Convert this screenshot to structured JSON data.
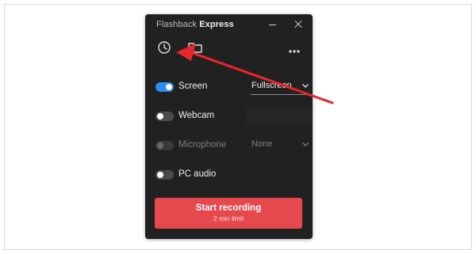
{
  "app": {
    "title_light": "Flashback",
    "title_bold": "Express"
  },
  "window_controls": {
    "minimize_icon": "minimize-icon",
    "close_icon": "close-icon"
  },
  "toolbar": {
    "history_icon": "clock-icon",
    "folder_icon": "folder-icon",
    "more_icon": "more-dots-icon"
  },
  "sources": {
    "screen": {
      "label": "Screen",
      "enabled": true,
      "select_value": "Fullscreen"
    },
    "webcam": {
      "label": "Webcam",
      "enabled": false,
      "select_value": ""
    },
    "microphone": {
      "label": "Microphone",
      "enabled": false,
      "disabled": true,
      "select_value": "None"
    },
    "pc_audio": {
      "label": "PC audio",
      "enabled": false
    }
  },
  "record": {
    "label": "Start recording",
    "sublabel": "2 min limit"
  },
  "colors": {
    "window_bg": "#212121",
    "accent_blue": "#2d8cf0",
    "record_red": "#e5484d",
    "annotation_red": "#e8262c"
  }
}
